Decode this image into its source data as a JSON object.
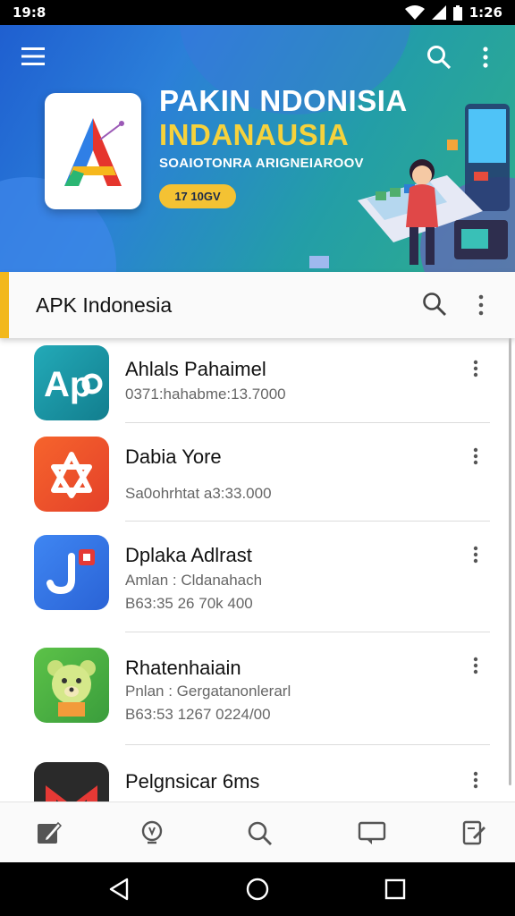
{
  "status_bar": {
    "time_left": "19:8",
    "time_right": "1:26"
  },
  "hero": {
    "title_line1": "PAKIN NDONISIA",
    "title_line2": "INDANAUSIA",
    "subtitle": "SOAIOTONRA ARIGNEIAROOV",
    "pill_label": "17 10GV",
    "colors": {
      "accent": "#f4c233",
      "title2": "#f6d23c"
    }
  },
  "appbar": {
    "title": "APK Indonesia",
    "accent": "#f2b81c"
  },
  "apps": [
    {
      "name": "Ahlals Pahaimel",
      "meta1": "0371:hahabme:13.7000",
      "meta2": "",
      "icon": "app-a-icon"
    },
    {
      "name": "Dabia Yore",
      "meta1": "",
      "meta2": "Sa0ohrhtat a3:33.000",
      "icon": "app-star-icon"
    },
    {
      "name": "Dplaka Adlrast",
      "meta1": "Amlan : Cldanahach",
      "meta2": "B63:35 26 70k 400",
      "icon": "app-j-icon"
    },
    {
      "name": "Rhatenhaiain",
      "meta1": "Pnlan : Gergatanonlerarl",
      "meta2": "B63:53 1267 0224/00",
      "icon": "bear-icon"
    },
    {
      "name": "Pelgnsicar 6ms",
      "meta1": "",
      "meta2": "",
      "icon": "gmail-icon"
    }
  ],
  "bottom_nav": [
    "edit-icon",
    "lightbulb-icon",
    "search-icon",
    "chat-icon",
    "notes-icon"
  ]
}
